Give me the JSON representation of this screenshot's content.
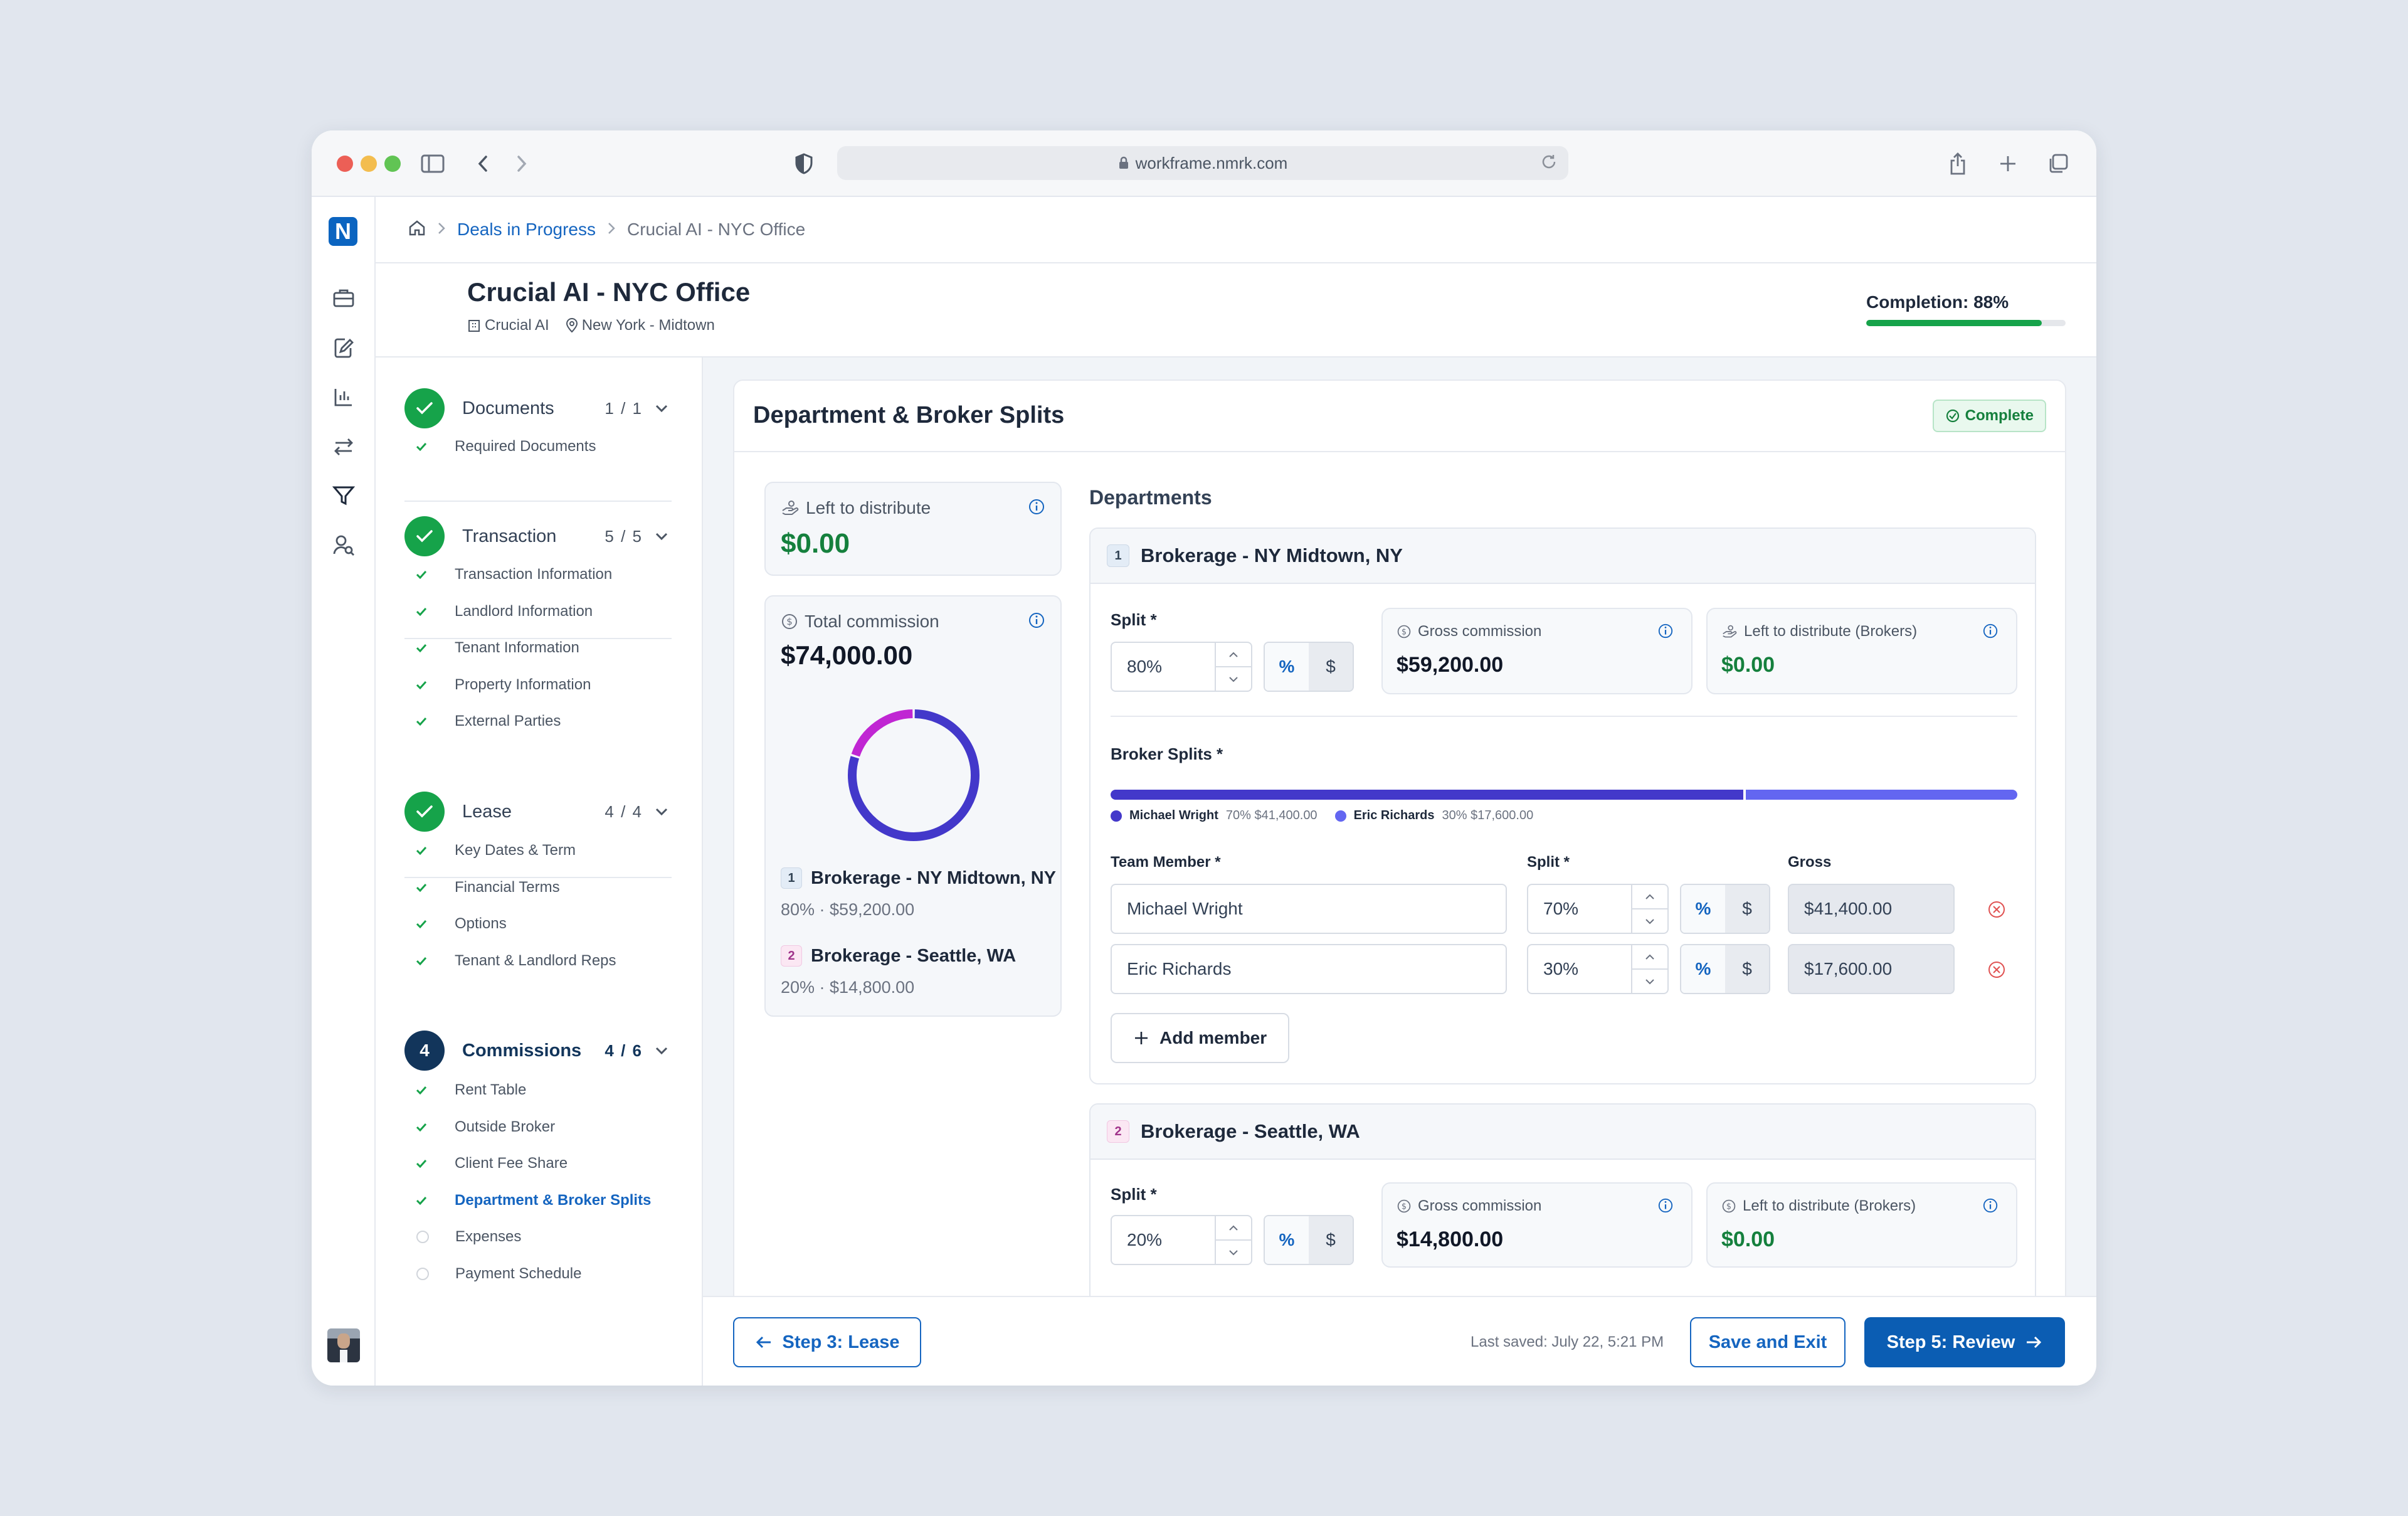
{
  "browser": {
    "url": "workframe.nmrk.com"
  },
  "app": {
    "logo": "N"
  },
  "breadcrumb": {
    "parent": "Deals in Progress",
    "current": "Crucial AI - NYC Office"
  },
  "deal": {
    "title": "Crucial AI - NYC Office",
    "company": "Crucial AI",
    "location": "New York - Midtown",
    "completion_label": "Completion: 88%",
    "completion_pct": 88
  },
  "steps": [
    {
      "name": "Documents",
      "count": "1 / 1",
      "items": [
        "Required Documents"
      ]
    },
    {
      "name": "Transaction",
      "count": "5 / 5",
      "items": [
        "Transaction Information",
        "Landlord Information",
        "Tenant Information",
        "Property Information",
        "External Parties"
      ]
    },
    {
      "name": "Lease",
      "count": "4 / 4",
      "items": [
        "Key Dates & Term",
        "Financial Terms",
        "Options",
        "Tenant & Landlord Reps"
      ]
    },
    {
      "name": "Commissions",
      "number": "4",
      "count": "4 / 6",
      "items": [
        "Rent Table",
        "Outside Broker",
        "Client Fee Share",
        "Department & Broker Splits",
        "Expenses",
        "Payment Schedule"
      ]
    }
  ],
  "card": {
    "title": "Department & Broker Splits",
    "status": "Complete"
  },
  "summary": {
    "left_label": "Left to distribute",
    "left_value": "$0.00",
    "total_label": "Total commission",
    "total_value": "$74,000.00",
    "donut": [
      {
        "name": "Brokerage - NY Midtown, NY",
        "share": 0.8,
        "color": "#4338ca"
      },
      {
        "name": "Brokerage - Seattle, WA",
        "share": 0.2,
        "color": "#c026d3"
      }
    ],
    "depts": [
      {
        "num": "1",
        "name": "Brokerage - NY Midtown, NY",
        "detail": "80% · $59,200.00"
      },
      {
        "num": "2",
        "name": "Brokerage - Seattle, WA",
        "detail": "20% · $14,800.00"
      }
    ]
  },
  "departments": {
    "title": "Departments",
    "split_label": "Split *",
    "gross_label": "Gross commission",
    "left_label": "Left to distribute (Brokers)",
    "pct": "%",
    "usd": "$",
    "d1": {
      "num": "1",
      "name": "Brokerage - NY Midtown, NY",
      "split": "80%",
      "gross": "$59,200.00",
      "left": "$0.00",
      "broker_label": "Broker Splits *",
      "bar": [
        {
          "share": 0.7,
          "color": "#4338ca"
        },
        {
          "share": 0.3,
          "color": "#6366f1"
        }
      ],
      "legend": [
        {
          "name": "Michael Wright",
          "info": "70% $41,400.00"
        },
        {
          "name": "Eric Richards",
          "info": "30% $17,600.00"
        }
      ],
      "col_member": "Team Member *",
      "col_split": "Split *",
      "col_gross": "Gross",
      "members": [
        {
          "name": "Michael Wright",
          "split": "70%",
          "gross": "$41,400.00"
        },
        {
          "name": "Eric Richards",
          "split": "30%",
          "gross": "$17,600.00"
        }
      ],
      "add": "Add member"
    },
    "d2": {
      "num": "2",
      "name": "Brokerage - Seattle, WA",
      "split": "20%",
      "gross": "$14,800.00",
      "left": "$0.00"
    }
  },
  "footer": {
    "back": "Step 3: Lease",
    "saved": "Last saved: July 22, 5:21 PM",
    "save_exit": "Save and Exit",
    "next": "Step 5: Review"
  }
}
